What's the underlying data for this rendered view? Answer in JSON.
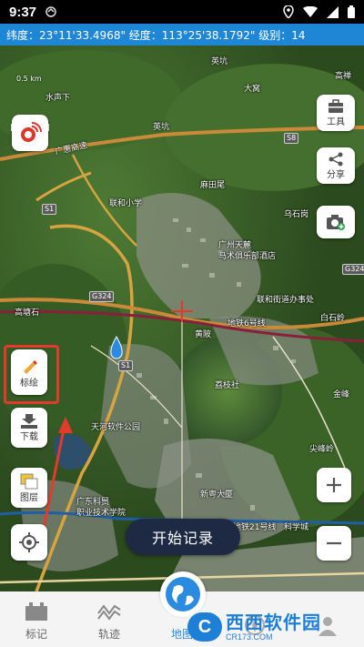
{
  "status": {
    "time": "9:37",
    "icons": [
      "location-icon",
      "wifi-icon",
      "signal-icon",
      "battery-icon"
    ]
  },
  "coord_bar": {
    "text": "纬度：23°11'33.4968\" 经度：113°25'38.1792\" 级别：14"
  },
  "map": {
    "scale_label": "0.5 km",
    "labels": [
      "英坑",
      "高禅",
      "水声下",
      "大窝",
      "英坑",
      "广惠高速",
      "联和小学",
      "麻田尾",
      "乌石岗",
      "广州天麓",
      "马术俱乐部酒店",
      "联和街道办事处",
      "黄陂",
      "地铁6号线",
      "高塘石",
      "白石岭",
      "金峰",
      "荔枝社",
      "天河软件公园",
      "广东科贸",
      "职业技术学院",
      "新粤大厦",
      "地铁21号线",
      "科学城",
      "尖峰岭"
    ],
    "road_badges": [
      "S8",
      "S1",
      "G324",
      "S1",
      "G324"
    ]
  },
  "right_controls": {
    "tools_label": "工具",
    "share_label": "分享"
  },
  "left_controls": {
    "mark_label": "标绘",
    "download_label": "下载",
    "layers_label": "图层"
  },
  "start_button": {
    "label": "开始记录"
  },
  "bottom_nav": {
    "items": [
      {
        "label": "标记",
        "icon": "castle-icon"
      },
      {
        "label": "轨迹",
        "icon": "track-icon"
      },
      {
        "label": "地图",
        "icon": "globe-icon"
      },
      {
        "label": "",
        "icon": "compass-icon"
      },
      {
        "label": "",
        "icon": "profile-icon"
      }
    ]
  },
  "watermark": {
    "text": "西西软件园",
    "url": "CR173.COM"
  },
  "colors": {
    "accent": "#1f86d6",
    "highlight": "#e23b2e",
    "start_button": "#1e2a44"
  }
}
